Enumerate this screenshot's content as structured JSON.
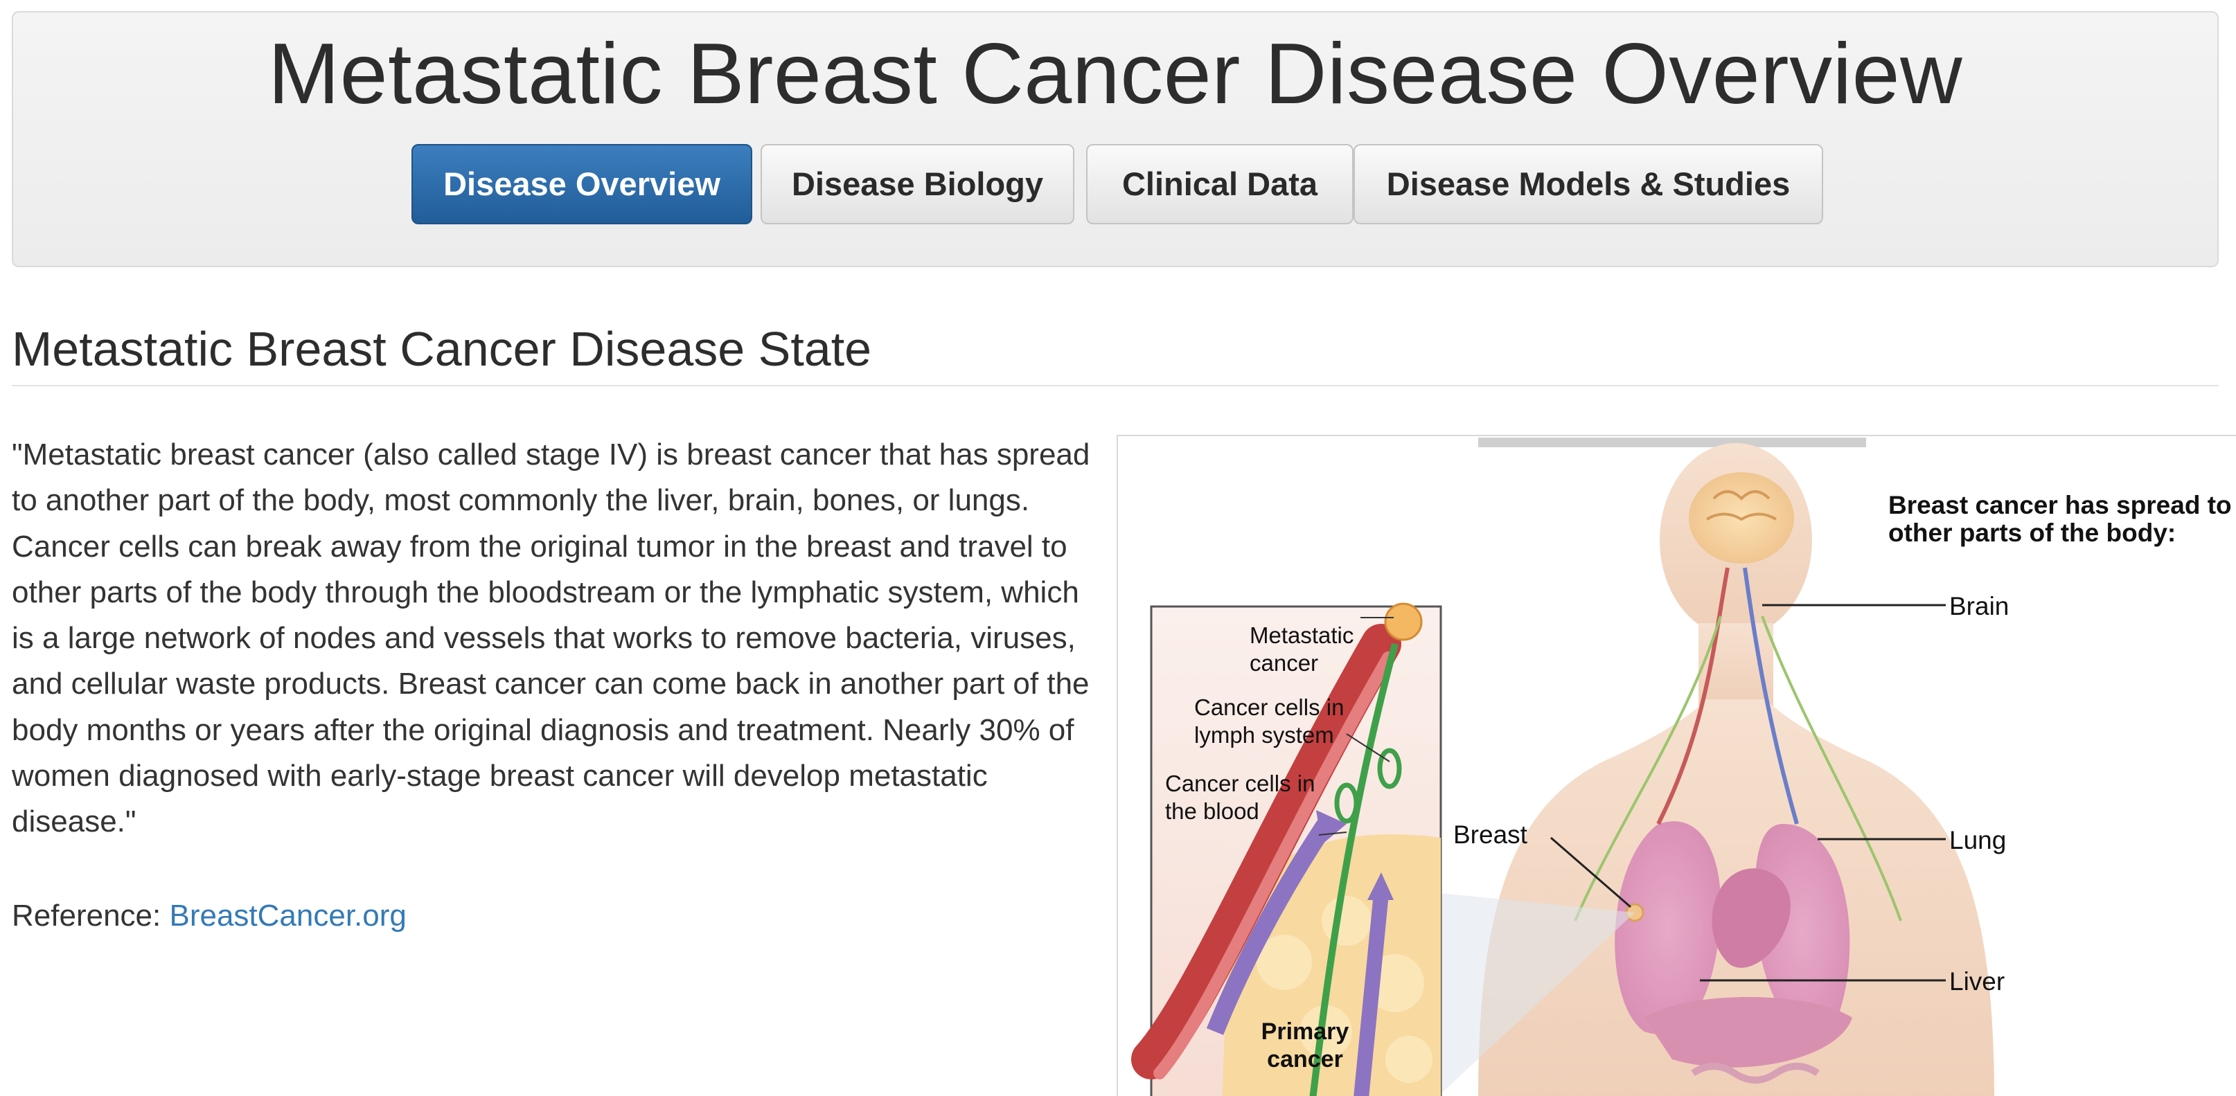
{
  "header": {
    "title": "Metastatic Breast Cancer Disease Overview",
    "tabs": [
      {
        "label": "Disease Overview",
        "active": true
      },
      {
        "label": "Disease Biology",
        "active": false
      },
      {
        "label": "Clinical Data",
        "active": false
      },
      {
        "label": "Disease Models & Studies",
        "active": false
      }
    ]
  },
  "section": {
    "title": "Metastatic Breast Cancer Disease State",
    "quote": "\"Metastatic breast cancer (also called stage IV) is breast cancer that has spread to another part of the body, most commonly the liver, brain, bones, or lungs. Cancer cells can break away from the original tumor in the breast and travel to other parts of the body through the bloodstream or the lymphatic system, which is a large network of nodes and vessels that works to remove bacteria, viruses, and cellular waste products. Breast cancer can come back in another part of the body months or years after the original diagnosis and treatment. Nearly 30% of women diagnosed with early-stage breast cancer will develop metastatic disease.\"",
    "reference_prefix": "Reference:",
    "reference_link": "BreastCancer.org"
  },
  "figure": {
    "heading": "Breast cancer has spread to other parts of the body:",
    "organ_labels": {
      "brain": "Brain",
      "lung": "Lung",
      "liver": "Liver",
      "breast": "Breast"
    },
    "inset_labels": {
      "metastatic_cancer": "Metastatic cancer",
      "lymph": "Cancer cells in lymph system",
      "blood": "Cancer cells in the blood",
      "primary": "Primary cancer"
    }
  },
  "colors": {
    "active_tab": "#2a6aab",
    "link": "#337ab7",
    "text": "#333333"
  }
}
